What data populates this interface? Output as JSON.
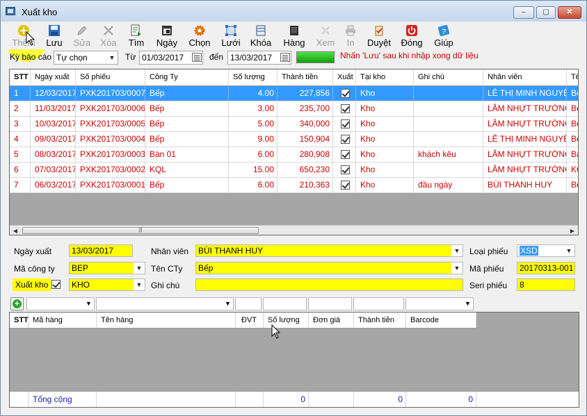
{
  "window": {
    "title": "Xuất kho",
    "buttons": {
      "minimize": "‒",
      "maximize": "▢",
      "close": "✕"
    }
  },
  "toolbar": {
    "items": [
      {
        "label": "Thêm",
        "icon": "add-icon",
        "enabled": true
      },
      {
        "label": "Lưu",
        "icon": "save-icon",
        "enabled": true
      },
      {
        "label": "Sửa",
        "icon": "edit-icon",
        "enabled": false
      },
      {
        "label": "Xóa",
        "icon": "delete-icon",
        "enabled": false
      },
      {
        "label": "Tìm",
        "icon": "find-icon",
        "enabled": true
      },
      {
        "label": "Ngày",
        "icon": "calendar-icon",
        "enabled": true
      },
      {
        "label": "Chọn",
        "icon": "gear-icon",
        "enabled": true
      },
      {
        "label": "Lưới",
        "icon": "grid-icon",
        "enabled": true
      },
      {
        "label": "Khóa",
        "icon": "lock-icon",
        "enabled": true
      },
      {
        "label": "Hàng",
        "icon": "goods-icon",
        "enabled": true
      },
      {
        "label": "Xem",
        "icon": "preview-icon",
        "enabled": false
      },
      {
        "label": "In",
        "icon": "print-icon",
        "enabled": false
      },
      {
        "label": "Duyệt",
        "icon": "approve-icon",
        "enabled": true
      },
      {
        "label": "Đóng",
        "icon": "power-icon",
        "enabled": true
      },
      {
        "label": "Giúp",
        "icon": "help-icon",
        "enabled": true
      }
    ]
  },
  "filter": {
    "period_label": "Kỳ báo cáo",
    "period_value": "Tự chọn",
    "from_label": "Từ",
    "from_value": "01/03/2017",
    "to_label": "đến",
    "to_value": "13/03/2017",
    "hint": "Nhấn 'Lưu' sau khi nhập xong dữ liệu"
  },
  "main_grid": {
    "columns": [
      "STT",
      "Ngày xuất",
      "Số phiếu",
      "Công Ty",
      "Số lượng",
      "Thành tiền",
      "Xuất",
      "Tại kho",
      "Ghi chú",
      "Nhân viên",
      "Tê"
    ],
    "rows": [
      {
        "stt": "1",
        "date": "12/03/2017",
        "voucher": "PXK201703/0007",
        "company": "Bếp",
        "qty": "4.00",
        "amount": "227,856",
        "exported": true,
        "warehouse": "Kho",
        "note": "",
        "staff": "LÊ THỊ MINH NGUYỆT",
        "extra": "Bế"
      },
      {
        "stt": "2",
        "date": "11/03/2017",
        "voucher": "PXK201703/0006",
        "company": "Bếp",
        "qty": "3.00",
        "amount": "235,700",
        "exported": true,
        "warehouse": "Kho",
        "note": "",
        "staff": "LÂM NHỰT TRƯỜNG",
        "extra": "Bế"
      },
      {
        "stt": "3",
        "date": "10/03/2017",
        "voucher": "PXK201703/0005",
        "company": "Bếp",
        "qty": "5.00",
        "amount": "340,000",
        "exported": true,
        "warehouse": "Kho",
        "note": "",
        "staff": "LÂM NHỰT TRƯỜNG",
        "extra": "Bế"
      },
      {
        "stt": "4",
        "date": "09/03/2017",
        "voucher": "PXK201703/0004",
        "company": "Bếp",
        "qty": "9.00",
        "amount": "150,904",
        "exported": true,
        "warehouse": "Kho",
        "note": "",
        "staff": "LÊ THỊ MINH NGUYỆT",
        "extra": "Bế"
      },
      {
        "stt": "5",
        "date": "08/03/2017",
        "voucher": "PXK201703/0003",
        "company": "Bàn 01",
        "qty": "6.00",
        "amount": "280,908",
        "exported": true,
        "warehouse": "Kho",
        "note": "khách kêu",
        "staff": "LÂM NHỰT TRƯỜNG",
        "extra": "Bà"
      },
      {
        "stt": "6",
        "date": "07/03/2017",
        "voucher": "PXK201703/0002",
        "company": "KQL",
        "qty": "15.00",
        "amount": "650,230",
        "exported": true,
        "warehouse": "Kho",
        "note": "",
        "staff": "LÂM NHỰT TRƯỜNG",
        "extra": "KQ"
      },
      {
        "stt": "7",
        "date": "06/03/2017",
        "voucher": "PXK201703/0001",
        "company": "Bếp",
        "qty": "6.00",
        "amount": "210,363",
        "exported": true,
        "warehouse": "Kho",
        "note": "đầu ngày",
        "staff": "BÙI THANH HUY",
        "extra": "Bế"
      }
    ]
  },
  "detail": {
    "date_label": "Ngày xuất",
    "date_value": "13/03/2017",
    "staff_label": "Nhân viên",
    "staff_value": "BÙI THANH HUY",
    "type_label": "Loại phiếu",
    "type_value": "XSD",
    "company_code_label": "Mã công ty",
    "company_code_value": "BEP",
    "company_name_label": "Tên CTy",
    "company_name_value": "Bếp",
    "voucher_code_label": "Mã phiếu",
    "voucher_code_value": "20170313-001",
    "export_label": "Xuất kho",
    "warehouse_value": "KHO",
    "note_label": "Ghi chú",
    "note_value": "",
    "serial_label": "Seri phiếu",
    "serial_value": "8"
  },
  "items_grid": {
    "columns": [
      "STT",
      "Mã hàng",
      "Tên hàng",
      "ĐVT",
      "Số lượng",
      "Đơn giá",
      "Thành tiền",
      "Barcode"
    ],
    "footer": {
      "label": "Tổng cộng",
      "qty_total": "0",
      "amount_total": "0",
      "barcode_total": "0"
    }
  },
  "colors": {
    "selected_row": "#3399ff",
    "row_text": "#cc0000",
    "highlight_field": "#ffff00",
    "hint_text": "#cc0000"
  }
}
